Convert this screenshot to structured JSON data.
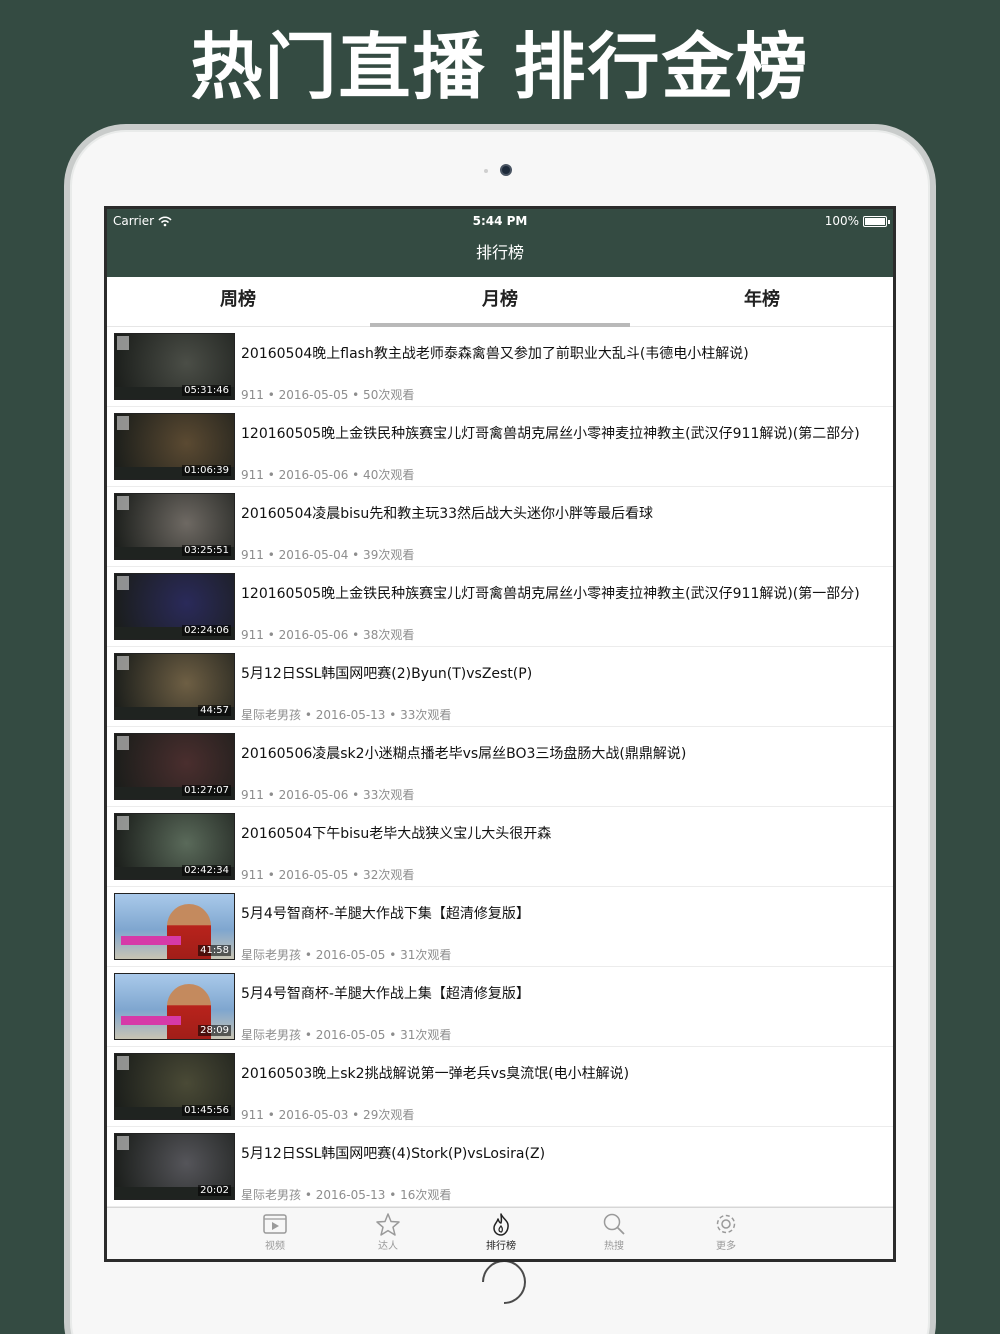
{
  "headline": "热门直播 排行金榜",
  "status_bar": {
    "carrier": "Carrier",
    "time": "5:44 PM",
    "battery": "100%"
  },
  "nav": {
    "title": "排行榜"
  },
  "tabs": [
    {
      "label": "周榜",
      "active": false
    },
    {
      "label": "月榜",
      "active": true
    },
    {
      "label": "年榜",
      "active": false
    }
  ],
  "videos": [
    {
      "title": "20160504晚上flash教主战老师泰森禽兽又参加了前职业大乱斗(韦德电小柱解说)",
      "meta": "911 • 2016-05-05 • 50次观看",
      "duration": "05:31:46",
      "thumb_color": "#4b4e47"
    },
    {
      "title": "120160505晚上金铁民种族赛宝儿灯哥禽兽胡克屌丝小零神麦拉神教主(武汉仔911解说)(第二部分)",
      "meta": "911 • 2016-05-06 • 40次观看",
      "duration": "01:06:39",
      "thumb_color": "#5b4a32"
    },
    {
      "title": "20160504凌晨bisu先和教主玩33然后战大头迷你小胖等最后看球",
      "meta": "911 • 2016-05-04 • 39次观看",
      "duration": "03:25:51",
      "thumb_color": "#6e6963"
    },
    {
      "title": "120160505晚上金铁民种族赛宝儿灯哥禽兽胡克屌丝小零神麦拉神教主(武汉仔911解说)(第一部分)",
      "meta": "911 • 2016-05-06 • 38次观看",
      "duration": "02:24:06",
      "thumb_color": "#2a2a5a"
    },
    {
      "title": "5月12日SSL韩国网吧赛(2)Byun(T)vsZest(P)",
      "meta": "星际老男孩 • 2016-05-13 • 33次观看",
      "duration": "44:57",
      "thumb_color": "#6e5f44"
    },
    {
      "title": "20160506凌晨sk2小迷糊点播老毕vs屌丝BO3三场盘肠大战(鼎鼎解说)",
      "meta": "911 • 2016-05-06 • 33次观看",
      "duration": "01:27:07",
      "thumb_color": "#4a2e2e"
    },
    {
      "title": "20160504下午bisu老毕大战狭义宝儿大头很开森",
      "meta": "911 • 2016-05-05 • 32次观看",
      "duration": "02:42:34",
      "thumb_color": "#5a6a5a"
    },
    {
      "title": "5月4号智商杯-羊腿大作战下集【超清修复版】",
      "meta": "星际老男孩 • 2016-05-05 • 31次观看",
      "duration": "41:58",
      "thumb_color": "#8fb4d8"
    },
    {
      "title": "5月4号智商杯-羊腿大作战上集【超清修复版】",
      "meta": "星际老男孩 • 2016-05-05 • 31次观看",
      "duration": "28:09",
      "thumb_color": "#8fb4d8"
    },
    {
      "title": "20160503晚上sk2挑战解说第一弹老兵vs臭流氓(电小柱解说)",
      "meta": "911 • 2016-05-03 • 29次观看",
      "duration": "01:45:56",
      "thumb_color": "#4a4a36"
    },
    {
      "title": "5月12日SSL韩国网吧赛(4)Stork(P)vsLosira(Z)",
      "meta": "星际老男孩 • 2016-05-13 • 16次观看",
      "duration": "20:02",
      "thumb_color": "#55555a"
    }
  ],
  "tabbar": [
    {
      "label": "视频",
      "icon": "video-icon",
      "active": false
    },
    {
      "label": "达人",
      "icon": "star-icon",
      "active": false
    },
    {
      "label": "排行榜",
      "icon": "flame-icon",
      "active": true
    },
    {
      "label": "热搜",
      "icon": "search-icon",
      "active": false
    },
    {
      "label": "更多",
      "icon": "gear-icon",
      "active": false
    }
  ]
}
